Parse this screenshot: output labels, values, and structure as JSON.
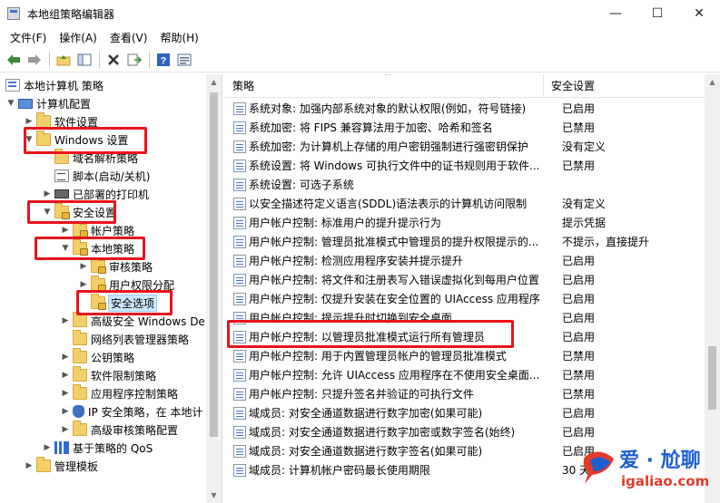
{
  "window": {
    "title": "本地组策略编辑器",
    "controls": {
      "minimize": "—",
      "maximize": "☐",
      "close": "✕"
    }
  },
  "menu": [
    "文件(F)",
    "操作(A)",
    "查看(V)",
    "帮助(H)"
  ],
  "toolbar": {
    "icons": [
      "back-icon",
      "forward-icon",
      "up-folder-icon",
      "show-hide-tree-icon",
      "delete-icon",
      "export-icon",
      "help-icon",
      "properties-icon"
    ]
  },
  "tree": [
    {
      "label": "本地计算机 策略",
      "icon": "policy-icon",
      "expander": ""
    },
    {
      "label": "计算机配置",
      "icon": "computer-icon",
      "expander": "down"
    },
    {
      "label": "软件设置",
      "icon": "folder-icon",
      "expander": "right"
    },
    {
      "label": "Windows 设置",
      "icon": "folder-icon",
      "expander": "down"
    },
    {
      "label": "域名解析策略",
      "icon": "folder-icon",
      "expander": ""
    },
    {
      "label": "脚本(启动/关机)",
      "icon": "script-icon",
      "expander": ""
    },
    {
      "label": "已部署的打印机",
      "icon": "printer-icon",
      "expander": "right"
    },
    {
      "label": "安全设置",
      "icon": "lock-folder-icon",
      "expander": "down"
    },
    {
      "label": "帐户策略",
      "icon": "lock-folder-icon",
      "expander": "right"
    },
    {
      "label": "本地策略",
      "icon": "lock-folder-icon",
      "expander": "down"
    },
    {
      "label": "审核策略",
      "icon": "lock-folder-icon",
      "expander": "right"
    },
    {
      "label": "用户权限分配",
      "icon": "lock-folder-icon",
      "expander": "right"
    },
    {
      "label": "安全选项",
      "icon": "lock-folder-icon",
      "expander": ""
    },
    {
      "label": "高级安全 Windows De",
      "icon": "folder-icon",
      "expander": "right"
    },
    {
      "label": "网络列表管理器策略",
      "icon": "folder-icon",
      "expander": ""
    },
    {
      "label": "公钥策略",
      "icon": "folder-icon",
      "expander": "right"
    },
    {
      "label": "软件限制策略",
      "icon": "folder-icon",
      "expander": "right"
    },
    {
      "label": "应用程序控制策略",
      "icon": "folder-icon",
      "expander": "right"
    },
    {
      "label": "IP 安全策略，在 本地计",
      "icon": "shield-icon",
      "expander": "right"
    },
    {
      "label": "高级审核策略配置",
      "icon": "folder-icon",
      "expander": "right"
    },
    {
      "label": "基于策略的 QoS",
      "icon": "qos-icon",
      "expander": "right"
    },
    {
      "label": "管理模板",
      "icon": "folder-icon",
      "expander": "right"
    }
  ],
  "list": {
    "columns": [
      "策略",
      "安全设置"
    ],
    "rows": [
      {
        "policy": "系统对象: 加强内部系统对象的默认权限(例如，符号链接)",
        "setting": "已启用"
      },
      {
        "policy": "系统加密: 将 FIPS 兼容算法用于加密、哈希和签名",
        "setting": "已禁用"
      },
      {
        "policy": "系统加密: 为计算机上存储的用户密钥强制进行强密钥保护",
        "setting": "没有定义"
      },
      {
        "policy": "系统设置: 将 Windows 可执行文件中的证书规则用于软件...",
        "setting": "已禁用"
      },
      {
        "policy": "系统设置: 可选子系统",
        "setting": ""
      },
      {
        "policy": "以安全描述符定义语言(SDDL)语法表示的计算机访问限制",
        "setting": "没有定义"
      },
      {
        "policy": "用户帐户控制: 标准用户的提升提示行为",
        "setting": "提示凭据"
      },
      {
        "policy": "用户帐户控制: 管理员批准模式中管理员的提升权限提示的...",
        "setting": "不提示，直接提升"
      },
      {
        "policy": "用户帐户控制: 检测应用程序安装并提示提升",
        "setting": "已启用"
      },
      {
        "policy": "用户帐户控制: 将文件和注册表写入错误虚拟化到每用户位置",
        "setting": "已启用"
      },
      {
        "policy": "用户帐户控制: 仅提升安装在安全位置的 UIAccess 应用程序",
        "setting": "已启用"
      },
      {
        "policy": "用户帐户控制: 提示提升时切换到安全桌面",
        "setting": "已启用"
      },
      {
        "policy": "用户帐户控制: 以管理员批准模式运行所有管理员",
        "setting": "已启用"
      },
      {
        "policy": "用户帐户控制: 用于内置管理员帐户的管理员批准模式",
        "setting": "已禁用"
      },
      {
        "policy": "用户帐户控制: 允许 UIAccess 应用程序在不使用安全桌面...",
        "setting": "已禁用"
      },
      {
        "policy": "用户帐户控制: 只提升签名并验证的可执行文件",
        "setting": "已禁用"
      },
      {
        "policy": "域成员: 对安全通道数据进行数字加密(如果可能)",
        "setting": "已启用"
      },
      {
        "policy": "域成员: 对安全通道数据进行数字加密或数字签名(始终)",
        "setting": "已启用"
      },
      {
        "policy": "域成员: 对安全通道数据进行数字签名(如果可能)",
        "setting": "已启用"
      },
      {
        "policy": "域成员: 计算机帐户密码最长使用期限",
        "setting": "30 天"
      }
    ]
  },
  "watermark": {
    "title": "爱 · 尬聊",
    "url": "igaliao.com"
  },
  "colors": {
    "highlight": "#e8141c",
    "selection": "#cce8ff"
  }
}
